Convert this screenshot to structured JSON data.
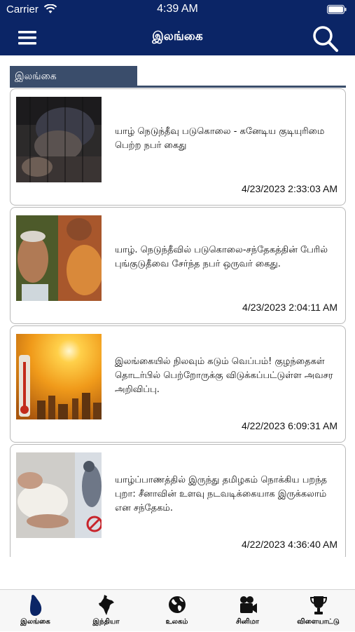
{
  "status_bar": {
    "carrier": "Carrier",
    "time": "4:39 AM"
  },
  "nav": {
    "title": "இலங்கை",
    "menu_icon": "hamburger-menu-icon",
    "search_icon": "search-icon"
  },
  "section": {
    "label": "இலங்கை"
  },
  "articles": [
    {
      "headline": "யாழ் நெடுந்தீவு படுகொலை  - கனேடிய குடியுரிமை பெற்ற நபர் கைது",
      "time": "4/23/2023 2:33:03 AM"
    },
    {
      "headline": "யாழ். நெடுந்தீவில் படுகொலை-சந்தேகத்தின் பேரில் புங்குடுதீவை சேர்ந்த நபர் ஒருவர் கைது.",
      "time": "4/23/2023 2:04:11 AM"
    },
    {
      "headline": "இலங்கையில் நிலவும் கடும் வெப்பம்! குழந்தைகள் தொடர்பில் பெற்றோருக்கு விடுக்கப்பட்டுள்ள அவசர அறிவிப்பு.",
      "time": "4/22/2023 6:09:31 AM"
    },
    {
      "headline": "யாழ்ப்பாணத்தில் இருந்து தமிழகம் நொக்கிய பறந்த புறா: சீனாவின் உளவு நடவடிக்கையாக இருக்கலாம் என சந்தேகம்.",
      "time": "4/22/2023 4:36:40 AM"
    }
  ],
  "tabs": [
    {
      "label": "இலங்கை",
      "icon": "sri-lanka-map-icon"
    },
    {
      "label": "இந்தியா",
      "icon": "india-map-icon"
    },
    {
      "label": "உலகம்",
      "icon": "globe-icon"
    },
    {
      "label": "சினிமா",
      "icon": "movie-camera-icon"
    },
    {
      "label": "விளையாட்டு",
      "icon": "trophy-icon"
    }
  ],
  "colors": {
    "nav_background": "#0b2566",
    "section_tab": "#3a4d6b",
    "active_tab_icon": "#0b2566"
  }
}
